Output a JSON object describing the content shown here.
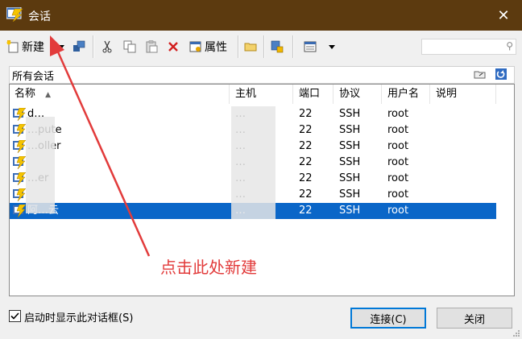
{
  "window": {
    "title": "会话",
    "close_glyph": "✕"
  },
  "toolbar": {
    "new_label": "新建",
    "properties_label": "属性",
    "icons": [
      "new-session-icon",
      "dropdown-arrow-icon",
      "connect-icon",
      "cut-icon",
      "copy-icon",
      "paste-icon",
      "delete-icon",
      "properties-icon",
      "folder-icon",
      "import-icon",
      "view-icon",
      "view-dropdown-icon"
    ]
  },
  "search": {
    "placeholder": "",
    "icon": "search-icon"
  },
  "path": {
    "label": "所有会话"
  },
  "table": {
    "headers": {
      "name": "名称",
      "host": "主机",
      "port": "端口",
      "protocol": "协议",
      "user": "用户名",
      "desc": "说明"
    },
    "rows": [
      {
        "name": "d…",
        "host": "…",
        "port": "22",
        "protocol": "SSH",
        "user": "root",
        "selected": false
      },
      {
        "name": "…pute",
        "host": "…",
        "port": "22",
        "protocol": "SSH",
        "user": "root",
        "selected": false
      },
      {
        "name": "…oller",
        "host": "…",
        "port": "22",
        "protocol": "SSH",
        "user": "root",
        "selected": false
      },
      {
        "name": "",
        "host": "…",
        "port": "22",
        "protocol": "SSH",
        "user": "root",
        "selected": false
      },
      {
        "name": "…er",
        "host": "…",
        "port": "22",
        "protocol": "SSH",
        "user": "root",
        "selected": false
      },
      {
        "name": "",
        "host": "…",
        "port": "22",
        "protocol": "SSH",
        "user": "root",
        "selected": false
      },
      {
        "name": "阿…云",
        "host": "…",
        "port": "22",
        "protocol": "SSH",
        "user": "root",
        "selected": true
      }
    ]
  },
  "annotation": {
    "text": "点击此处新建",
    "color": "#e23b3b"
  },
  "footer": {
    "startup_checkbox_label": "启动时显示此对话框(S)",
    "startup_checked": true,
    "connect_label": "连接(C)",
    "close_label": "关闭"
  },
  "colors": {
    "titlebar": "#5c3a0f",
    "selection": "#0a66c8"
  }
}
